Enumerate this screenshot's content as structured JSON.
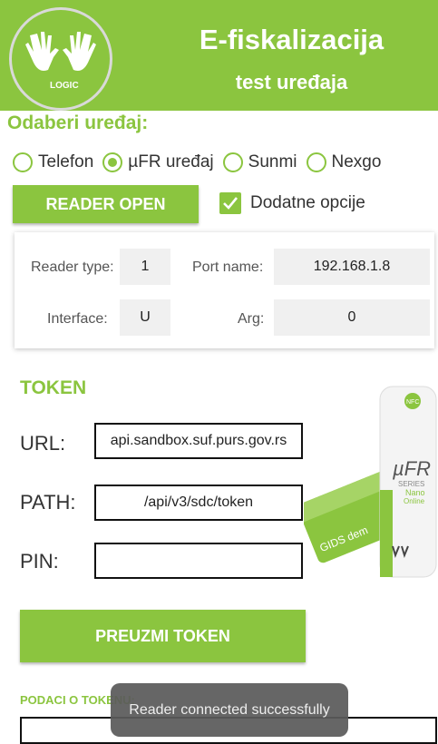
{
  "header": {
    "logo_text": "LOGIC",
    "title": "E-fiskalizacija",
    "subtitle": "test uređaja"
  },
  "device_select": {
    "label": "Odaberi uređaj:",
    "options": [
      {
        "label": "Telefon",
        "selected": false
      },
      {
        "label": "µFR uređaj",
        "selected": true
      },
      {
        "label": "Sunmi",
        "selected": false
      },
      {
        "label": "Nexgo",
        "selected": false
      }
    ]
  },
  "reader_button": "READER OPEN",
  "extra_options": {
    "label": "Dodatne opcije",
    "checked": true
  },
  "reader_settings": {
    "reader_type_label": "Reader type:",
    "reader_type_value": "1",
    "port_name_label": "Port name:",
    "port_name_value": "192.168.1.8",
    "interface_label": "Interface:",
    "interface_value": "U",
    "arg_label": "Arg:",
    "arg_value": "0"
  },
  "token": {
    "title": "TOKEN",
    "url_label": "URL:",
    "url_value": "api.sandbox.suf.purs.gov.rs",
    "path_label": "PATH:",
    "path_value": "/api/v3/sdc/token",
    "pin_label": "PIN:",
    "pin_value": "",
    "button": "PREUZMI TOKEN"
  },
  "illustration": {
    "card_text": "GIDS dem",
    "device_brand": "µFR",
    "device_series": "SERIES",
    "device_model1": "Nano",
    "device_model2": "Online",
    "nfc": "NFC"
  },
  "podaci_label": "PODACI O TOKENU:",
  "toast": "Reader connected successfully",
  "colors": {
    "accent": "#8bc53f"
  }
}
